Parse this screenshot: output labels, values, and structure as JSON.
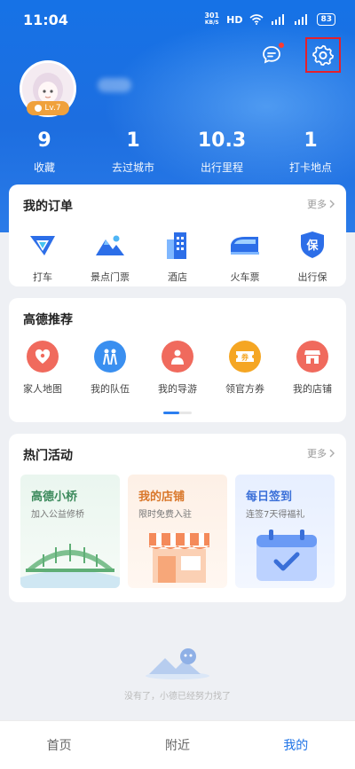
{
  "status_bar": {
    "time": "11:04",
    "net_speed_top": "301",
    "net_speed_unit": "KB/S",
    "hd_label": "HD",
    "battery": "83"
  },
  "header": {
    "level": "Lv.7",
    "stats": [
      {
        "value": "9",
        "label": "收藏"
      },
      {
        "value": "1",
        "label": "去过城市"
      },
      {
        "value": "10.3",
        "label": "出行里程"
      },
      {
        "value": "1",
        "label": "打卡地点"
      }
    ]
  },
  "orders": {
    "title": "我的订单",
    "more": "更多",
    "items": [
      {
        "label": "打车",
        "icon": "taxi-icon"
      },
      {
        "label": "景点门票",
        "icon": "mountain-ticket-icon"
      },
      {
        "label": "酒店",
        "icon": "hotel-building-icon"
      },
      {
        "label": "火车票",
        "icon": "train-icon"
      },
      {
        "label": "出行保",
        "icon": "insurance-shield-icon"
      }
    ]
  },
  "recommend": {
    "title": "高德推荐",
    "items": [
      {
        "label": "家人地图",
        "icon": "family-map-icon",
        "color": "#f06a5d"
      },
      {
        "label": "我的队伍",
        "icon": "team-icon",
        "color": "#3a8ff0"
      },
      {
        "label": "我的导游",
        "icon": "guide-icon",
        "color": "#f06a5d"
      },
      {
        "label": "领官方券",
        "icon": "coupon-icon",
        "color": "#f5a623"
      },
      {
        "label": "我的店铺",
        "icon": "shop-icon",
        "color": "#f06a5d"
      }
    ]
  },
  "activities": {
    "title": "热门活动",
    "more": "更多",
    "cards": [
      {
        "title": "高德小桥",
        "subtitle": "加入公益修桥",
        "icon": "bridge-illustration"
      },
      {
        "title": "我的店铺",
        "subtitle": "限时免费入驻",
        "icon": "store-illustration"
      },
      {
        "title": "每日签到",
        "subtitle": "连签7天得福礼",
        "icon": "calendar-check-illustration"
      }
    ]
  },
  "empty_state": {
    "text": "没有了，小德已经努力找了"
  },
  "tabbar": {
    "tabs": [
      {
        "label": "首页",
        "active": false
      },
      {
        "label": "附近",
        "active": false
      },
      {
        "label": "我的",
        "active": true
      }
    ]
  },
  "colors": {
    "header_blue": "#1672e6",
    "accent_blue": "#1f73e6",
    "highlight_red": "#e5202b"
  }
}
